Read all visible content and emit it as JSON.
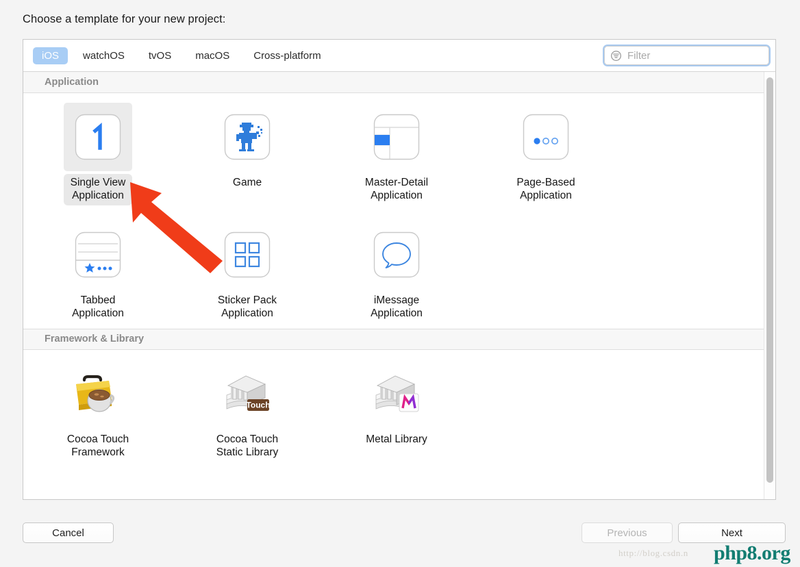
{
  "prompt": "Choose a template for your new project:",
  "tabs": [
    {
      "label": "iOS",
      "active": true
    },
    {
      "label": "watchOS",
      "active": false
    },
    {
      "label": "tvOS",
      "active": false
    },
    {
      "label": "macOS",
      "active": false
    },
    {
      "label": "Cross-platform",
      "active": false
    }
  ],
  "filter": {
    "placeholder": "Filter",
    "value": "",
    "icon": "filter-circle-icon"
  },
  "sections": [
    {
      "title": "Application",
      "items": [
        {
          "label": "Single View\nApplication",
          "icon": "single-view-icon",
          "selected": true
        },
        {
          "label": "Game",
          "icon": "game-robot-icon",
          "selected": false
        },
        {
          "label": "Master-Detail\nApplication",
          "icon": "master-detail-icon",
          "selected": false
        },
        {
          "label": "Page-Based\nApplication",
          "icon": "page-based-icon",
          "selected": false
        },
        {
          "label": "Tabbed\nApplication",
          "icon": "tabbed-icon",
          "selected": false
        },
        {
          "label": "Sticker Pack\nApplication",
          "icon": "sticker-pack-icon",
          "selected": false
        },
        {
          "label": "iMessage\nApplication",
          "icon": "imessage-icon",
          "selected": false
        }
      ]
    },
    {
      "title": "Framework & Library",
      "items": [
        {
          "label": "Cocoa Touch\nFramework",
          "icon": "toolbox-coffee-icon",
          "selected": false
        },
        {
          "label": "Cocoa Touch\nStatic Library",
          "icon": "library-touch-icon",
          "selected": false
        },
        {
          "label": "Metal Library",
          "icon": "library-metal-icon",
          "selected": false
        }
      ]
    }
  ],
  "footer": {
    "cancel": "Cancel",
    "previous": "Previous",
    "next": "Next",
    "previous_disabled": true
  },
  "annotation": {
    "arrow_color": "#f03c19",
    "points_to": "Single View Application"
  },
  "watermark": {
    "url": "http://blog.csdn.n",
    "brand": "php8.org"
  },
  "colors": {
    "accent_blue": "#2b7ef0",
    "tab_active_bg": "#a8cdf5",
    "focus_ring": "#a8c9ef",
    "selection_bg": "#ebebeb",
    "panel_bg": "#ffffff",
    "page_bg": "#f4f4f4",
    "section_header_text": "#8a8a8a",
    "arrow_red": "#f03c19",
    "watermark_teal": "#127d72"
  }
}
